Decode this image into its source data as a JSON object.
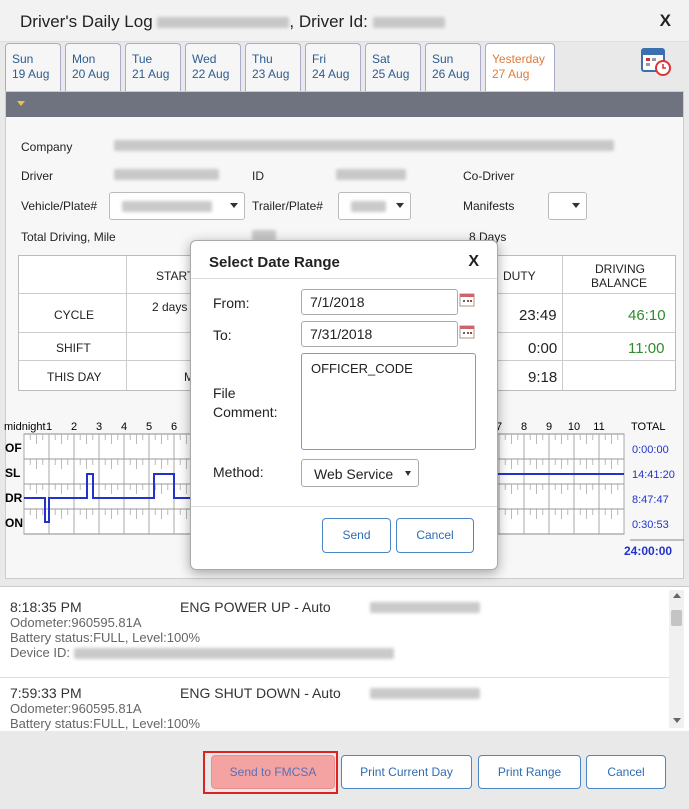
{
  "window": {
    "title_prefix": "Driver's Daily Log",
    "title_driver_id_label": ", Driver Id:",
    "close": "X"
  },
  "tabs": [
    {
      "day": "Sun",
      "date": "19 Aug"
    },
    {
      "day": "Mon",
      "date": "20 Aug"
    },
    {
      "day": "Tue",
      "date": "21 Aug"
    },
    {
      "day": "Wed",
      "date": "22 Aug"
    },
    {
      "day": "Thu",
      "date": "23 Aug"
    },
    {
      "day": "Fri",
      "date": "24 Aug"
    },
    {
      "day": "Sat",
      "date": "25 Aug"
    },
    {
      "day": "Sun",
      "date": "26 Aug"
    },
    {
      "day": "Yesterday",
      "date": "27 Aug"
    }
  ],
  "info": {
    "company_label": "Company",
    "driver_label": "Driver",
    "id_label": "ID",
    "codriver_label": "Co-Driver",
    "vehicle_label": "Vehicle/Plate#",
    "trailer_label": "Trailer/Plate#",
    "manifests_label": "Manifests",
    "total_driving_label": "Total Driving, Mile",
    "days": "8 Days"
  },
  "summary": {
    "col_start": "START",
    "col_duty": "DUTY",
    "col_balance_1": "DRIVING",
    "col_balance_2": "BALANCE",
    "rows": [
      {
        "label": "CYCLE",
        "start": "2 days",
        "duty": "23:49",
        "balance": "46:10"
      },
      {
        "label": "SHIFT",
        "start": "",
        "duty": "0:00",
        "balance": "11:00"
      },
      {
        "label": "THIS DAY",
        "start": "M",
        "duty": "9:18",
        "balance": ""
      }
    ]
  },
  "graph": {
    "midnight": "midnight",
    "hours": [
      "1",
      "2",
      "3",
      "4",
      "5",
      "6",
      "7",
      "8",
      "9",
      "10",
      "11"
    ],
    "rows": [
      "OF",
      "SL",
      "DR",
      "ON"
    ],
    "total_label": "TOTAL",
    "totals": [
      "0:00:00",
      "14:41:20",
      "8:47:47",
      "0:30:53"
    ],
    "grand_total": "24:00:00"
  },
  "events": [
    {
      "time": "8:18:35 PM",
      "event": "ENG POWER UP - Auto",
      "odometer": "Odometer:960595.81A",
      "battery": "Battery status:FULL, Level:100%",
      "device": "Device ID:"
    },
    {
      "time": "7:59:33 PM",
      "event": "ENG SHUT DOWN - Auto",
      "odometer": "Odometer:960595.81A",
      "battery": "Battery status:FULL, Level:100%"
    }
  ],
  "footer": {
    "send_fmcsa": "Send to FMCSA",
    "print_day": "Print Current Day",
    "print_range": "Print Range",
    "cancel": "Cancel"
  },
  "dialog": {
    "title": "Select Date Range",
    "close": "X",
    "from_label": "From:",
    "from_value": "7/1/2018",
    "to_label": "To:",
    "to_value": "7/31/2018",
    "comment_label_1": "File",
    "comment_label_2": "Comment:",
    "comment_value": "OFFICER_CODE",
    "method_label": "Method:",
    "method_value": "Web Service",
    "send": "Send",
    "cancel": "Cancel"
  },
  "colors": {
    "balance_green": "#2e8b2e",
    "total_blue": "#2233cc",
    "tab_active": "#e07a3c",
    "link_blue": "#2d6cb3",
    "send_fmcsa_bg": "#f4a2a2"
  }
}
